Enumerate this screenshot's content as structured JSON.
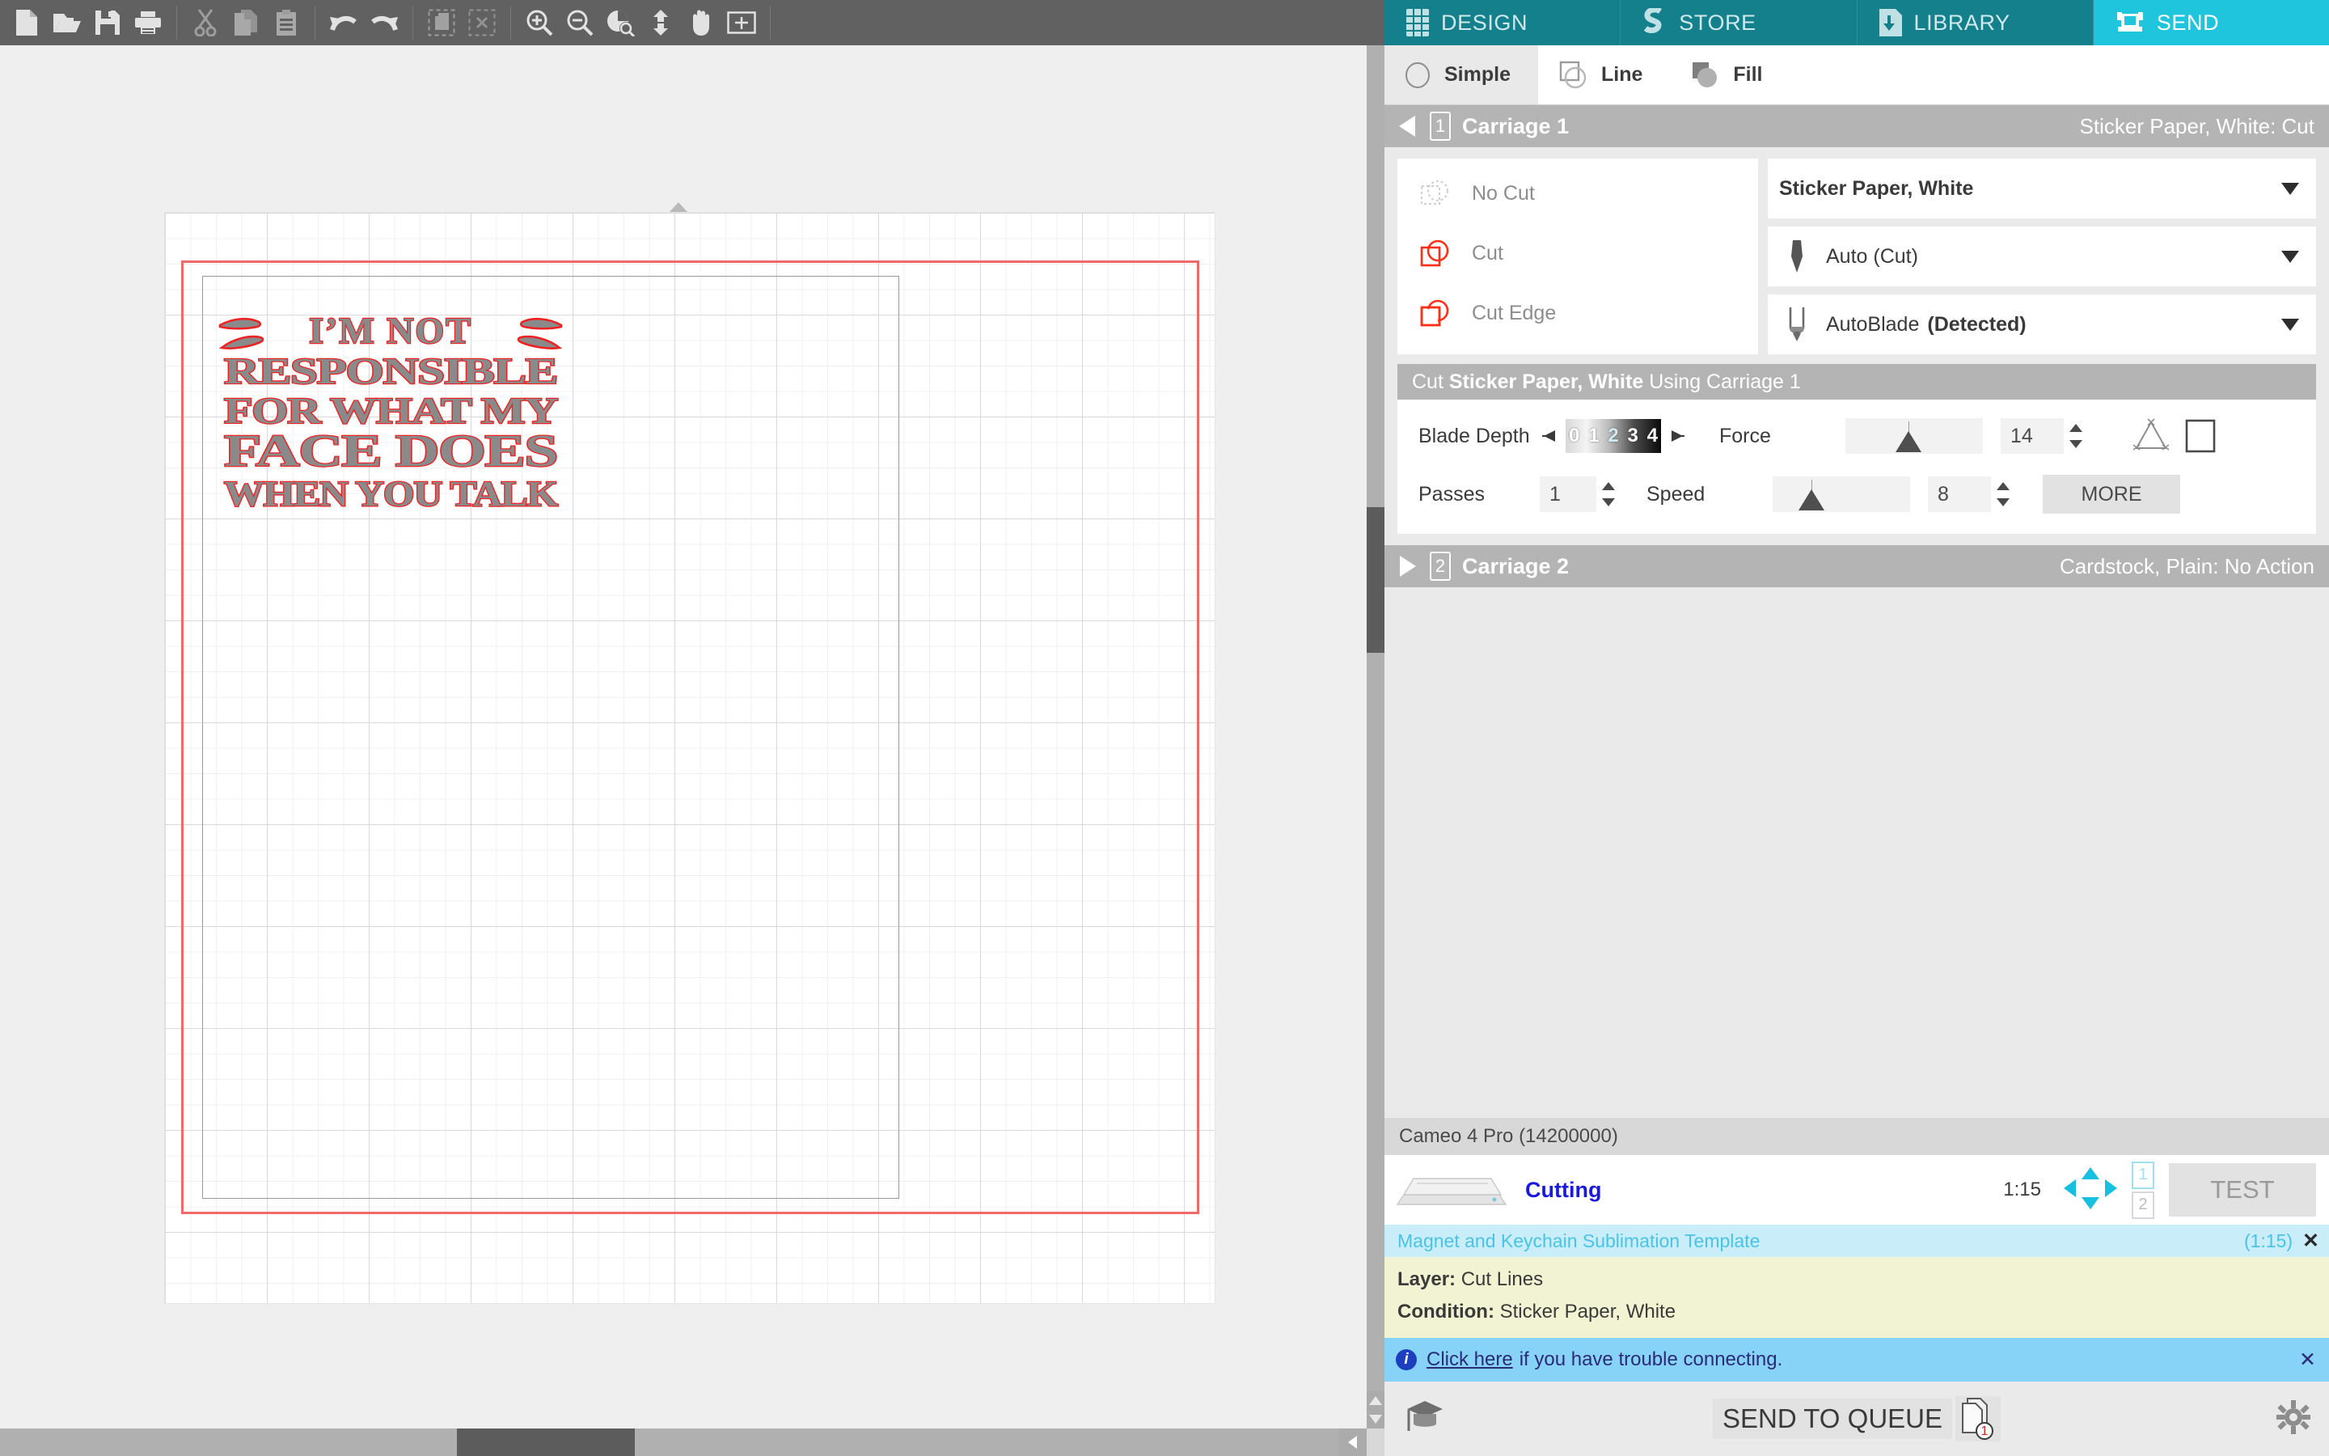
{
  "toolbar": {
    "buttons": [
      {
        "name": "new-document-icon",
        "label": "New"
      },
      {
        "name": "open-file-icon",
        "label": "Open"
      },
      {
        "name": "save-icon",
        "label": "Save"
      },
      {
        "name": "print-icon",
        "label": "Print"
      },
      {
        "name": "cut-icon",
        "label": "Cut"
      },
      {
        "name": "copy-icon",
        "label": "Copy"
      },
      {
        "name": "paste-icon",
        "label": "Paste"
      },
      {
        "name": "undo-icon",
        "label": "Undo"
      },
      {
        "name": "redo-icon",
        "label": "Redo"
      },
      {
        "name": "select-all-icon",
        "label": "Select All"
      },
      {
        "name": "deselect-all-icon",
        "label": "Deselect All"
      },
      {
        "name": "zoom-in-icon",
        "label": "Zoom In"
      },
      {
        "name": "zoom-out-icon",
        "label": "Zoom Out"
      },
      {
        "name": "zoom-selection-icon",
        "label": "Zoom to Selection"
      },
      {
        "name": "fit-to-window-icon",
        "label": "Fit To Window"
      },
      {
        "name": "pan-icon",
        "label": "Pan"
      },
      {
        "name": "show-grid-icon",
        "label": "Show Grid"
      }
    ]
  },
  "canvas": {
    "design_text_lines": [
      "I'M NOT",
      "RESPONSIBLE",
      "FOR WHAT MY",
      "FACE DOES",
      "WHEN YOU TALK"
    ],
    "fill_color": "#8a8a8a",
    "stroke_color": "#ee2222",
    "cut_border_color": "#f16a6a"
  },
  "nav": {
    "tabs": [
      {
        "label": "DESIGN",
        "icon": "grid-icon",
        "active": false
      },
      {
        "label": "STORE",
        "icon": "store-icon",
        "active": false
      },
      {
        "label": "LIBRARY",
        "icon": "library-icon",
        "active": false
      },
      {
        "label": "SEND",
        "icon": "send-cutter-icon",
        "active": true
      }
    ],
    "accent_active": "#1fc4dd",
    "accent_base": "#14808c"
  },
  "mode_tabs": [
    {
      "label": "Simple",
      "icon": "circle-icon",
      "active": true
    },
    {
      "label": "Line",
      "icon": "line-shapes-icon",
      "active": false
    },
    {
      "label": "Fill",
      "icon": "fill-shapes-icon",
      "active": false
    }
  ],
  "carriage1": {
    "number": "1",
    "title": "Carriage 1",
    "summary": "Sticker Paper, White: Cut",
    "expanded_arrow": "triangle-left",
    "actions": [
      {
        "label": "No Cut",
        "icon": "no-cut-icon",
        "selected": false
      },
      {
        "label": "Cut",
        "icon": "cut-shape-icon",
        "selected": false
      },
      {
        "label": "Cut Edge",
        "icon": "cut-edge-icon",
        "selected": false
      }
    ],
    "material": "Sticker Paper, White",
    "tool_action": "Auto (Cut)",
    "blade": "AutoBlade",
    "blade_status": "(Detected)",
    "cut_using_prefix": "Cut",
    "cut_using_material": "Sticker Paper, White",
    "cut_using_suffix": "Using Carriage 1",
    "params": {
      "blade_depth_label": "Blade Depth",
      "blade_depth_ticks": [
        "0",
        "1",
        "2",
        "3",
        "4"
      ],
      "passes_label": "Passes",
      "passes_value": "1",
      "force_label": "Force",
      "force_value": "14",
      "speed_label": "Speed",
      "speed_value": "8",
      "more_label": "MORE"
    }
  },
  "carriage2": {
    "number": "2",
    "title": "Carriage 2",
    "summary": "Cardstock, Plain: No Action",
    "collapsed_arrow": "triangle-right"
  },
  "device": {
    "name": "Cameo 4 Pro (14200000)",
    "status": "Cutting",
    "eta": "1:15",
    "carriage_pips": [
      {
        "label": "1",
        "active": true
      },
      {
        "label": "2",
        "active": false
      }
    ],
    "test_label": "TEST"
  },
  "job": {
    "name": "Magnet and Keychain Sublimation Template",
    "time": "(1:15)",
    "close": "✕",
    "layer_label": "Layer:",
    "layer_value": "Cut Lines",
    "condition_label": "Condition:",
    "condition_value": "Sticker Paper, White"
  },
  "connect_bar": {
    "link": "Click here",
    "text": "if you have trouble connecting.",
    "close": "✕",
    "info_glyph": "i"
  },
  "footer": {
    "tutorial_icon": "graduation-cap-icon",
    "send_label": "SEND TO QUEUE",
    "queue_count": "1",
    "settings_icon": "gear-icon"
  }
}
